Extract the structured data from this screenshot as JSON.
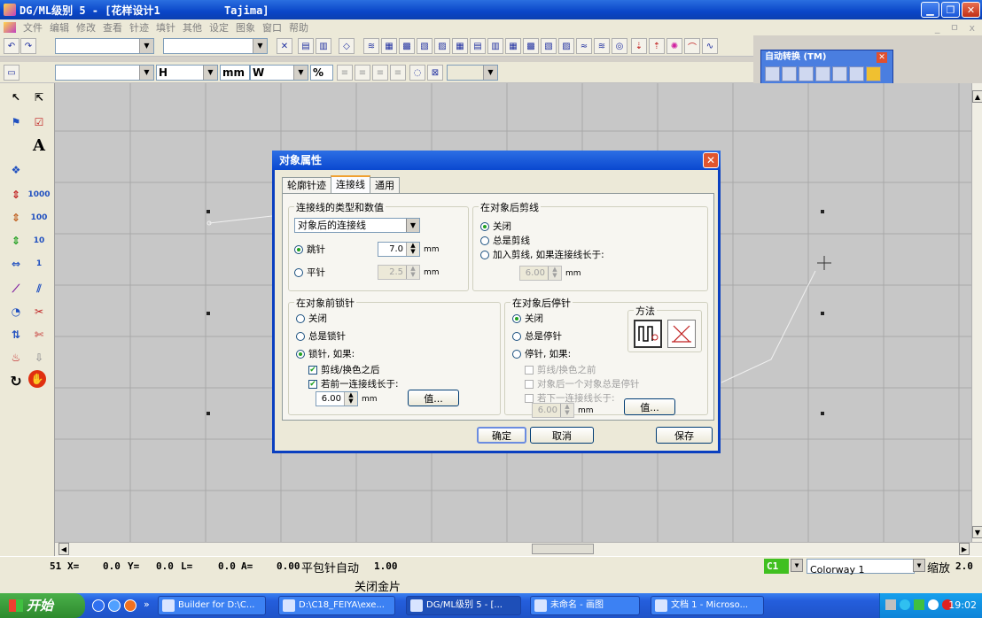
{
  "window": {
    "title": "DG/ML级别 5 - [花样设计1          Tajima]"
  },
  "menu": {
    "items": [
      "文件",
      "编辑",
      "修改",
      "查看",
      "针迹",
      "填针",
      "其他",
      "设定",
      "图象",
      "窗口",
      "帮助"
    ]
  },
  "toolbar2": {
    "unit_h": "H",
    "unit_mm": "mm",
    "unit_w": "W",
    "unit_pct": "%"
  },
  "palette": {
    "title": "自动转换 (TM)"
  },
  "left_tools": {
    "text_tool": "A",
    "l1000": "1000",
    "l100": "100",
    "l10": "10",
    "l1": "1"
  },
  "status": {
    "index": "51",
    "x_label": "X=",
    "x_value": "0.0",
    "y_label": "Y=",
    "y_value": "0.0",
    "l_label": "L=",
    "l_value": "0.0",
    "a_label": "A=",
    "a_value": "0.00",
    "mode": "平包针自动",
    "mode_value": "1.00",
    "color_code": "C1",
    "colorway": "Colorway 1",
    "zoom_label": "缩放",
    "zoom_value": "2.0",
    "hint": "关闭金片"
  },
  "taskbar": {
    "start": "开始",
    "chevron": "»",
    "tasks": [
      "Builder for D:\\C...",
      "D:\\C18_FEIYA\\exe...",
      "DG/ML级别 5 - [...",
      "未命名 - 画图",
      "文档 1 - Microso..."
    ],
    "clock": "19:02"
  },
  "dialog": {
    "title": "对象属性",
    "close": "✕",
    "tabs": [
      "轮廓针迹",
      "连接线",
      "通用"
    ],
    "conn_group": {
      "label": "连接线的类型和数值",
      "select": "对象后的连接线",
      "jump": "跳针",
      "jump_value": "7.0",
      "flat": "平针",
      "flat_value": "2.5",
      "mm": "mm"
    },
    "trim_group": {
      "label": "在对象后剪线",
      "off": "关闭",
      "always": "总是剪线",
      "add": "加入剪线, 如果连接线长于:",
      "value": "6.00",
      "mm": "mm"
    },
    "lock_before": {
      "label": "在对象前锁针",
      "off": "关闭",
      "always": "总是锁针",
      "if": "锁针, 如果:",
      "after_trim": "剪线/换色之后",
      "if_longer": "若前一连接线长于:",
      "value": "6.00",
      "mm": "mm",
      "values_btn": "值..."
    },
    "tie_after": {
      "label": "在对象后停针",
      "off": "关闭",
      "always": "总是停针",
      "if": "停针, 如果:",
      "before_trim": "剪线/换色之前",
      "always_obj": "对象后一个对象总是停针",
      "if_next_longer": "若下一连接线长于:",
      "value": "6.00",
      "mm": "mm",
      "values_btn": "值...",
      "method_label": "方法"
    },
    "ok": "确定",
    "cancel": "取消",
    "save": "保存"
  },
  "colors": {
    "titlebar": "#0a46c8",
    "canvas": "#c7c7c7",
    "dialog_border": "#0a3fc0",
    "color_code": "#40c020"
  }
}
